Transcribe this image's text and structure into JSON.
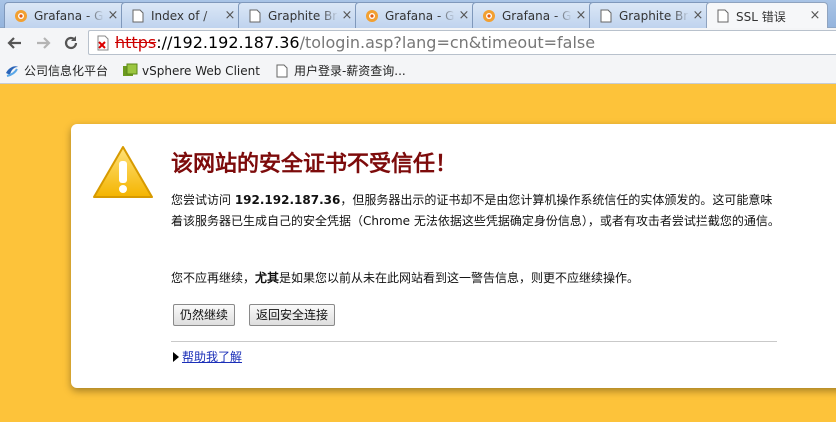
{
  "tabs": [
    {
      "title": "Grafana - Graphite",
      "icon": "grafana-icon"
    },
    {
      "title": "Index of /",
      "icon": "document-icon"
    },
    {
      "title": "Graphite Browser",
      "icon": "document-icon"
    },
    {
      "title": "Grafana - Graphite",
      "icon": "grafana-icon"
    },
    {
      "title": "Grafana - Graphite",
      "icon": "grafana-icon"
    },
    {
      "title": "Graphite Browser",
      "icon": "document-icon"
    },
    {
      "title": "SSL 错误",
      "icon": "document-icon",
      "active": true
    }
  ],
  "address": {
    "scheme": "https",
    "host": "://192.192.187.36",
    "path": "/tologin.asp?lang=cn&timeout=false"
  },
  "bookmarks": [
    {
      "label": "公司信息化平台",
      "icon": "company-icon"
    },
    {
      "label": "vSphere Web Client",
      "icon": "vsphere-icon"
    },
    {
      "label": "用户登录-薪资查询...",
      "icon": "document-icon"
    }
  ],
  "interstitial": {
    "headline": "该网站的安全证书不受信任！",
    "para1_prefix": "您尝试访问 ",
    "para1_host": "192.192.187.36",
    "para1_suffix": "，但服务器出示的证书却不是由您计算机操作系统信任的实体颁发的。这可能意味着该服务器已生成自己的安全凭据（Chrome 无法依据这些凭据确定身份信息），或者有攻击者尝试拦截您的通信。",
    "para2_prefix": "您不应再继续，",
    "para2_bold": "尤其",
    "para2_suffix": "是如果您以前从未在此网站看到这一警告信息，则更不应继续操作。",
    "proceed_label": "仍然继续",
    "back_label": "返回安全连接",
    "help_label": "帮助我了解"
  },
  "colors": {
    "page_background": "#fdc33a",
    "headline": "#7d0b0b",
    "link": "#1b2fb8",
    "scheme_error": "#cc0000"
  }
}
